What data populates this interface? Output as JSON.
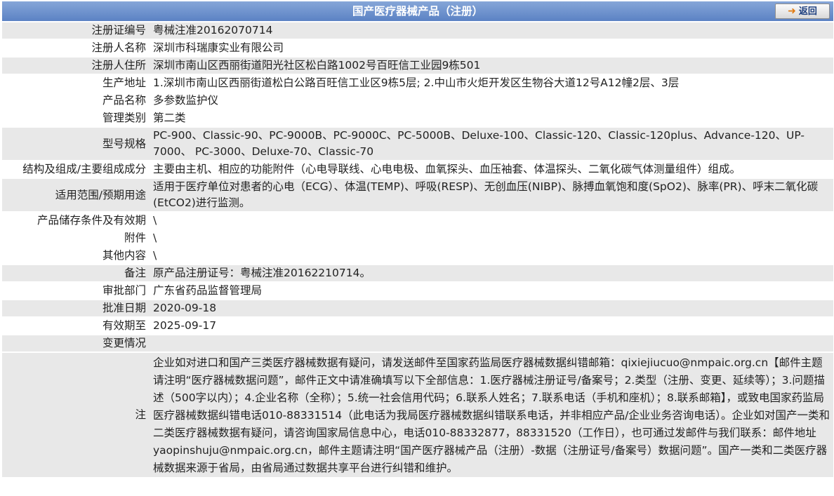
{
  "header": {
    "title": "国产医疗器械产品（注册）",
    "back_label": "返回",
    "back_icon": "arrow-right-icon"
  },
  "fields": [
    {
      "label": "注册证编号",
      "value": "粤械注准20162070714"
    },
    {
      "label": "注册人名称",
      "value": "深圳市科瑞康实业有限公司"
    },
    {
      "label": "注册人住所",
      "value": "深圳市南山区西丽街道阳光社区松白路1002号百旺信工业园9栋501"
    },
    {
      "label": "生产地址",
      "value": "1.深圳市南山区西丽街道松白公路百旺信工业区9栋5层; 2.中山市火炬开发区生物谷大道12号A12幢2层、3层"
    },
    {
      "label": "产品名称",
      "value": "多参数监护仪"
    },
    {
      "label": "管理类别",
      "value": "第二类"
    },
    {
      "label": "型号规格",
      "value": "PC-900、Classic-90、PC-9000B、PC-9000C、PC-5000B、Deluxe-100、Classic-120、Classic-120plus、Advance-120、UP-7000、 PC-3000、Deluxe-70、Classic-70"
    },
    {
      "label": "结构及组成/主要组成成分",
      "value": "主要由主机、相应的功能附件（心电导联线、心电电极、血氧探头、血压袖套、体温探头、二氧化碳气体测量组件）组成。"
    },
    {
      "label": "适用范围/预期用途",
      "value": "适用于医疗单位对患者的心电（ECG）、体温(TEMP)、呼吸(RESP)、无创血压(NIBP)、脉搏血氧饱和度(SpO2)、脉率(PR)、呼末二氧化碳(EtCO2)进行监测。"
    },
    {
      "label": "产品储存条件及有效期",
      "value": "\\"
    },
    {
      "label": "附件",
      "value": "\\"
    },
    {
      "label": "其他内容",
      "value": "\\"
    },
    {
      "label": "备注",
      "value": "原产品注册证号：粤械注准20162210714。"
    },
    {
      "label": "审批部门",
      "value": "广东省药品监督管理局"
    },
    {
      "label": "批准日期",
      "value": "2020-09-18"
    },
    {
      "label": "有效期至",
      "value": "2025-09-17"
    },
    {
      "label": "变更情况",
      "value": ""
    }
  ],
  "note": {
    "label": "注",
    "text": "企业如对进口和国产三类医疗器械数据有疑问，请发送邮件至国家药监局医疗器械数据纠错邮箱：qixiejiucuo@nmpaic.org.cn【邮件主题请注明“医疗器械数据问题”，邮件正文中请准确填写以下全部信息：1.医疗器械注册证号/备案号；2.类型（注册、变更、延续等）；3.问题描述（500字以内）；4.企业名称（全称）；5.统一社会信用代码；6.联系人姓名；7.联系电话（手机和座机）；8.联系邮箱】，或致电国家药监局医疗器械数据纠错电话010-88331514（此电话为我局医疗器械数据纠错联系电话，并非相应产品/企业业务咨询电话）。企业如对国产一类和二类医疗器械数据有疑问，请咨询国家局信息中心，电话010-88332877，88331520（工作日），也可通过发邮件与我们联系：邮件地址yaopinshuju@nmpaic.org.cn，邮件主题请注明“国产医疗器械产品（注册）-数据（注册证号/备案号）数据问题”。国产一类和二类医疗器械数据来源于省局，由省局通过数据共享平台进行纠错和维护。"
  }
}
